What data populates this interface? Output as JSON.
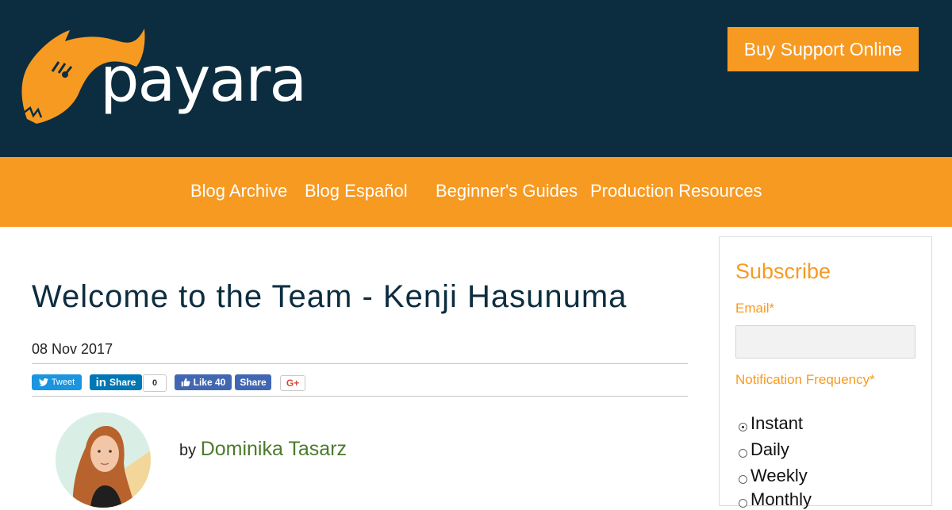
{
  "header": {
    "logo_text": "payara",
    "buy_button": "Buy Support Online"
  },
  "nav": {
    "items": [
      "Blog Archive",
      "Blog Español",
      "Beginner's Guides",
      "Production Resources"
    ]
  },
  "article": {
    "title": "Welcome to the Team - Kenji Hasunuma",
    "date": "08 Nov 2017",
    "by_prefix": "by",
    "author": "Dominika Tasarz"
  },
  "share": {
    "tweet": "Tweet",
    "linkedin": "Share",
    "linkedin_count": "0",
    "fb_like": "Like 40",
    "fb_share": "Share",
    "gplus": "G+"
  },
  "sidebar": {
    "title": "Subscribe",
    "email_label": "Email*",
    "frequency_label": "Notification Frequency*",
    "options": [
      "Instant",
      "Daily",
      "Weekly",
      "Monthly"
    ],
    "selected": "Instant"
  },
  "colors": {
    "header_bg": "#0c2d40",
    "accent": "#f79a22",
    "author_link": "#4a7a2b"
  }
}
